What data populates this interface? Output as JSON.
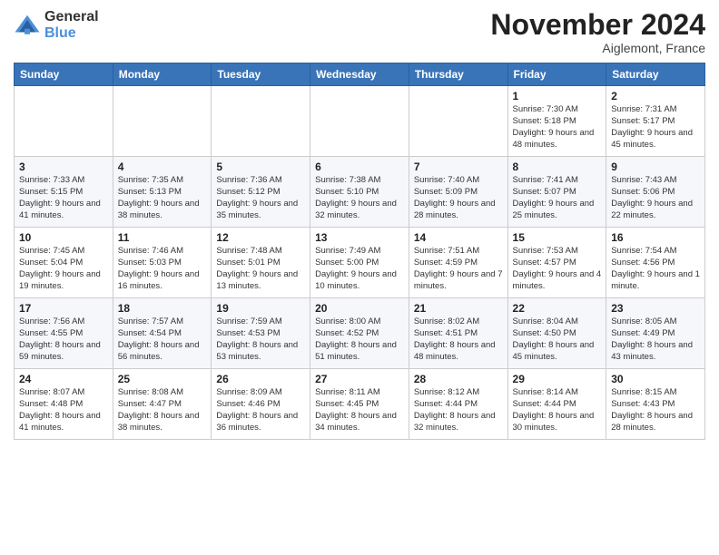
{
  "logo": {
    "general": "General",
    "blue": "Blue"
  },
  "title": "November 2024",
  "location": "Aiglemont, France",
  "days_of_week": [
    "Sunday",
    "Monday",
    "Tuesday",
    "Wednesday",
    "Thursday",
    "Friday",
    "Saturday"
  ],
  "weeks": [
    [
      {
        "day": "",
        "info": ""
      },
      {
        "day": "",
        "info": ""
      },
      {
        "day": "",
        "info": ""
      },
      {
        "day": "",
        "info": ""
      },
      {
        "day": "",
        "info": ""
      },
      {
        "day": "1",
        "info": "Sunrise: 7:30 AM\nSunset: 5:18 PM\nDaylight: 9 hours and 48 minutes."
      },
      {
        "day": "2",
        "info": "Sunrise: 7:31 AM\nSunset: 5:17 PM\nDaylight: 9 hours and 45 minutes."
      }
    ],
    [
      {
        "day": "3",
        "info": "Sunrise: 7:33 AM\nSunset: 5:15 PM\nDaylight: 9 hours and 41 minutes."
      },
      {
        "day": "4",
        "info": "Sunrise: 7:35 AM\nSunset: 5:13 PM\nDaylight: 9 hours and 38 minutes."
      },
      {
        "day": "5",
        "info": "Sunrise: 7:36 AM\nSunset: 5:12 PM\nDaylight: 9 hours and 35 minutes."
      },
      {
        "day": "6",
        "info": "Sunrise: 7:38 AM\nSunset: 5:10 PM\nDaylight: 9 hours and 32 minutes."
      },
      {
        "day": "7",
        "info": "Sunrise: 7:40 AM\nSunset: 5:09 PM\nDaylight: 9 hours and 28 minutes."
      },
      {
        "day": "8",
        "info": "Sunrise: 7:41 AM\nSunset: 5:07 PM\nDaylight: 9 hours and 25 minutes."
      },
      {
        "day": "9",
        "info": "Sunrise: 7:43 AM\nSunset: 5:06 PM\nDaylight: 9 hours and 22 minutes."
      }
    ],
    [
      {
        "day": "10",
        "info": "Sunrise: 7:45 AM\nSunset: 5:04 PM\nDaylight: 9 hours and 19 minutes."
      },
      {
        "day": "11",
        "info": "Sunrise: 7:46 AM\nSunset: 5:03 PM\nDaylight: 9 hours and 16 minutes."
      },
      {
        "day": "12",
        "info": "Sunrise: 7:48 AM\nSunset: 5:01 PM\nDaylight: 9 hours and 13 minutes."
      },
      {
        "day": "13",
        "info": "Sunrise: 7:49 AM\nSunset: 5:00 PM\nDaylight: 9 hours and 10 minutes."
      },
      {
        "day": "14",
        "info": "Sunrise: 7:51 AM\nSunset: 4:59 PM\nDaylight: 9 hours and 7 minutes."
      },
      {
        "day": "15",
        "info": "Sunrise: 7:53 AM\nSunset: 4:57 PM\nDaylight: 9 hours and 4 minutes."
      },
      {
        "day": "16",
        "info": "Sunrise: 7:54 AM\nSunset: 4:56 PM\nDaylight: 9 hours and 1 minute."
      }
    ],
    [
      {
        "day": "17",
        "info": "Sunrise: 7:56 AM\nSunset: 4:55 PM\nDaylight: 8 hours and 59 minutes."
      },
      {
        "day": "18",
        "info": "Sunrise: 7:57 AM\nSunset: 4:54 PM\nDaylight: 8 hours and 56 minutes."
      },
      {
        "day": "19",
        "info": "Sunrise: 7:59 AM\nSunset: 4:53 PM\nDaylight: 8 hours and 53 minutes."
      },
      {
        "day": "20",
        "info": "Sunrise: 8:00 AM\nSunset: 4:52 PM\nDaylight: 8 hours and 51 minutes."
      },
      {
        "day": "21",
        "info": "Sunrise: 8:02 AM\nSunset: 4:51 PM\nDaylight: 8 hours and 48 minutes."
      },
      {
        "day": "22",
        "info": "Sunrise: 8:04 AM\nSunset: 4:50 PM\nDaylight: 8 hours and 45 minutes."
      },
      {
        "day": "23",
        "info": "Sunrise: 8:05 AM\nSunset: 4:49 PM\nDaylight: 8 hours and 43 minutes."
      }
    ],
    [
      {
        "day": "24",
        "info": "Sunrise: 8:07 AM\nSunset: 4:48 PM\nDaylight: 8 hours and 41 minutes."
      },
      {
        "day": "25",
        "info": "Sunrise: 8:08 AM\nSunset: 4:47 PM\nDaylight: 8 hours and 38 minutes."
      },
      {
        "day": "26",
        "info": "Sunrise: 8:09 AM\nSunset: 4:46 PM\nDaylight: 8 hours and 36 minutes."
      },
      {
        "day": "27",
        "info": "Sunrise: 8:11 AM\nSunset: 4:45 PM\nDaylight: 8 hours and 34 minutes."
      },
      {
        "day": "28",
        "info": "Sunrise: 8:12 AM\nSunset: 4:44 PM\nDaylight: 8 hours and 32 minutes."
      },
      {
        "day": "29",
        "info": "Sunrise: 8:14 AM\nSunset: 4:44 PM\nDaylight: 8 hours and 30 minutes."
      },
      {
        "day": "30",
        "info": "Sunrise: 8:15 AM\nSunset: 4:43 PM\nDaylight: 8 hours and 28 minutes."
      }
    ]
  ]
}
